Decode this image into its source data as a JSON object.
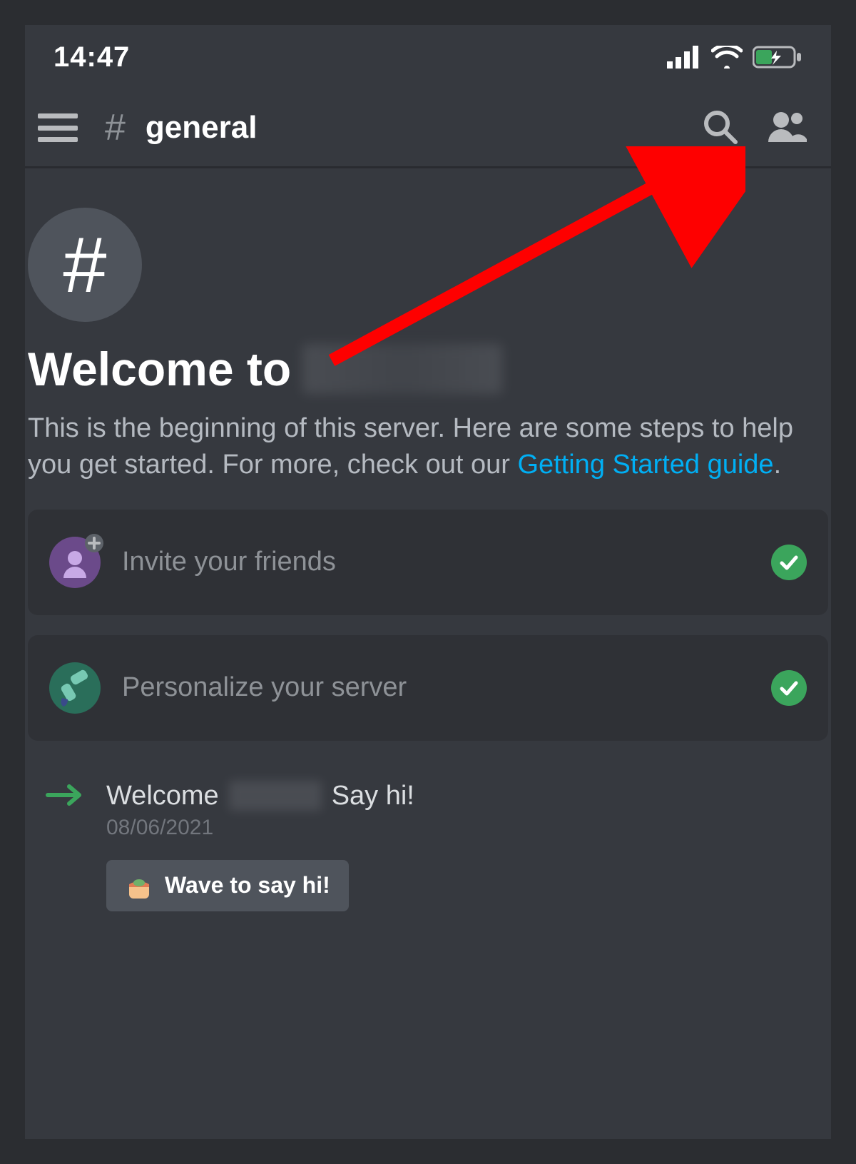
{
  "status": {
    "time": "14:47"
  },
  "header": {
    "channel_name": "general"
  },
  "welcome": {
    "title_prefix": "Welcome to",
    "desc_part1": "This is the beginning of this server. Here are some steps to help you get started. For more, check out our ",
    "link_text": "Getting Started guide",
    "desc_part2": "."
  },
  "steps": [
    {
      "label": "Invite your friends",
      "completed": true
    },
    {
      "label": "Personalize your server",
      "completed": true
    }
  ],
  "system_message": {
    "text_prefix": "Welcome",
    "text_suffix": "Say hi!",
    "date": "08/06/2021",
    "wave_label": "Wave to say hi!"
  },
  "colors": {
    "accent_link": "#00aff4",
    "success": "#3ba55c",
    "annotation": "#ff0000"
  }
}
